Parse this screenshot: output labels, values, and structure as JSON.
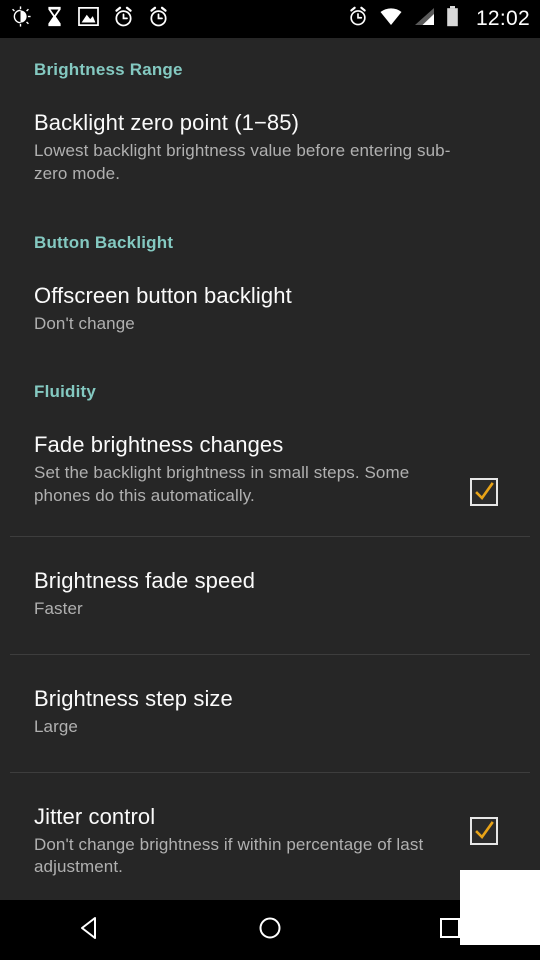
{
  "status_bar": {
    "clock": "12:02",
    "left_icons": [
      {
        "name": "brightness-icon"
      },
      {
        "name": "hourglass-icon"
      },
      {
        "name": "image-icon"
      },
      {
        "name": "alarm-clock-icon"
      },
      {
        "name": "alarm-clock-icon-2"
      }
    ],
    "right_icons": [
      {
        "name": "alarm-clock-icon"
      },
      {
        "name": "wifi-icon"
      },
      {
        "name": "cell-signal-icon"
      },
      {
        "name": "battery-icon"
      }
    ]
  },
  "settings": {
    "categories": [
      {
        "header": "Brightness Range",
        "items": [
          {
            "title": "Backlight zero point (1−85)",
            "summary": "Lowest backlight brightness value before entering sub-zero mode.",
            "checkbox": null
          }
        ]
      },
      {
        "header": "Button Backlight",
        "items": [
          {
            "title": "Offscreen button backlight",
            "summary": "Don't change",
            "checkbox": null
          }
        ]
      },
      {
        "header": "Fluidity",
        "items": [
          {
            "title": "Fade brightness changes",
            "summary": "Set the backlight brightness in small steps. Some phones do this automatically.",
            "checkbox": "checked"
          },
          {
            "title": "Brightness fade speed",
            "summary": "Faster",
            "checkbox": null
          },
          {
            "title": "Brightness step size",
            "summary": "Large",
            "checkbox": null
          },
          {
            "title": "Jitter control",
            "summary": "Don't change brightness if within percentage of last adjustment.",
            "checkbox": "checked"
          }
        ]
      }
    ]
  },
  "nav_bar": {
    "buttons": [
      {
        "name": "back-button",
        "icon": "triangle-left-icon"
      },
      {
        "name": "home-button",
        "icon": "circle-icon"
      },
      {
        "name": "recents-button",
        "icon": "square-icon"
      }
    ]
  },
  "colors": {
    "background": "#262626",
    "category_accent": "#84c9c1",
    "title_text": "#fafafa",
    "summary_text": "#b0b0b0",
    "divider": "#3d3d3d",
    "checkbox_border": "#e6e6e6",
    "checkbox_mark": "#e8a317",
    "system_bar": "#000000"
  }
}
